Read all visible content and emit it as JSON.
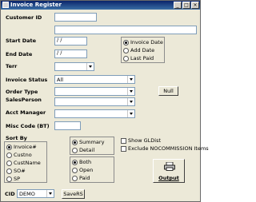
{
  "window": {
    "title": "Invoice Register",
    "minimize": "_",
    "maximize": "□",
    "close": "×"
  },
  "form": {
    "customer_id_label": "Customer ID",
    "customer_id_value": "",
    "customer_name_value": "",
    "start_date_label": "Start Date",
    "start_date_value": " / /",
    "end_date_label": "End Date",
    "end_date_value": " / /",
    "terr_label": "Terr",
    "terr_value": "",
    "invoice_status_label": "Invoice Status",
    "invoice_status_value": "All",
    "order_type_label": "Order Type",
    "order_type_value": "",
    "null_button": "Null",
    "salesperson_label": "SalesPerson",
    "salesperson_value": "",
    "acct_manager_label": "Acct Manager",
    "acct_manager_value": "",
    "misc_code_label": "Misc Code (BT)",
    "misc_code_value": ""
  },
  "date_options": {
    "items": [
      "Invoice Date",
      "Add Date",
      "Last Paid"
    ],
    "selected": 0
  },
  "sort_by": {
    "title": "Sort By",
    "items": [
      "Invoice#",
      "Custno",
      "CustName",
      "SO#",
      "SP"
    ],
    "selected": 0
  },
  "detail_options": {
    "items": [
      "Summary",
      "Detail"
    ],
    "selected": 0
  },
  "open_options": {
    "items": [
      "Both",
      "Open",
      "Paid"
    ],
    "selected": 0
  },
  "checkboxes": {
    "show_gldist": "Show GLDist",
    "exclude_nocommission": "Exclude NOCOMMISSION Items"
  },
  "footer": {
    "cid_label": "CID",
    "cid_value": "DEMO",
    "save_rs": "SaveRS",
    "output": "Output"
  }
}
